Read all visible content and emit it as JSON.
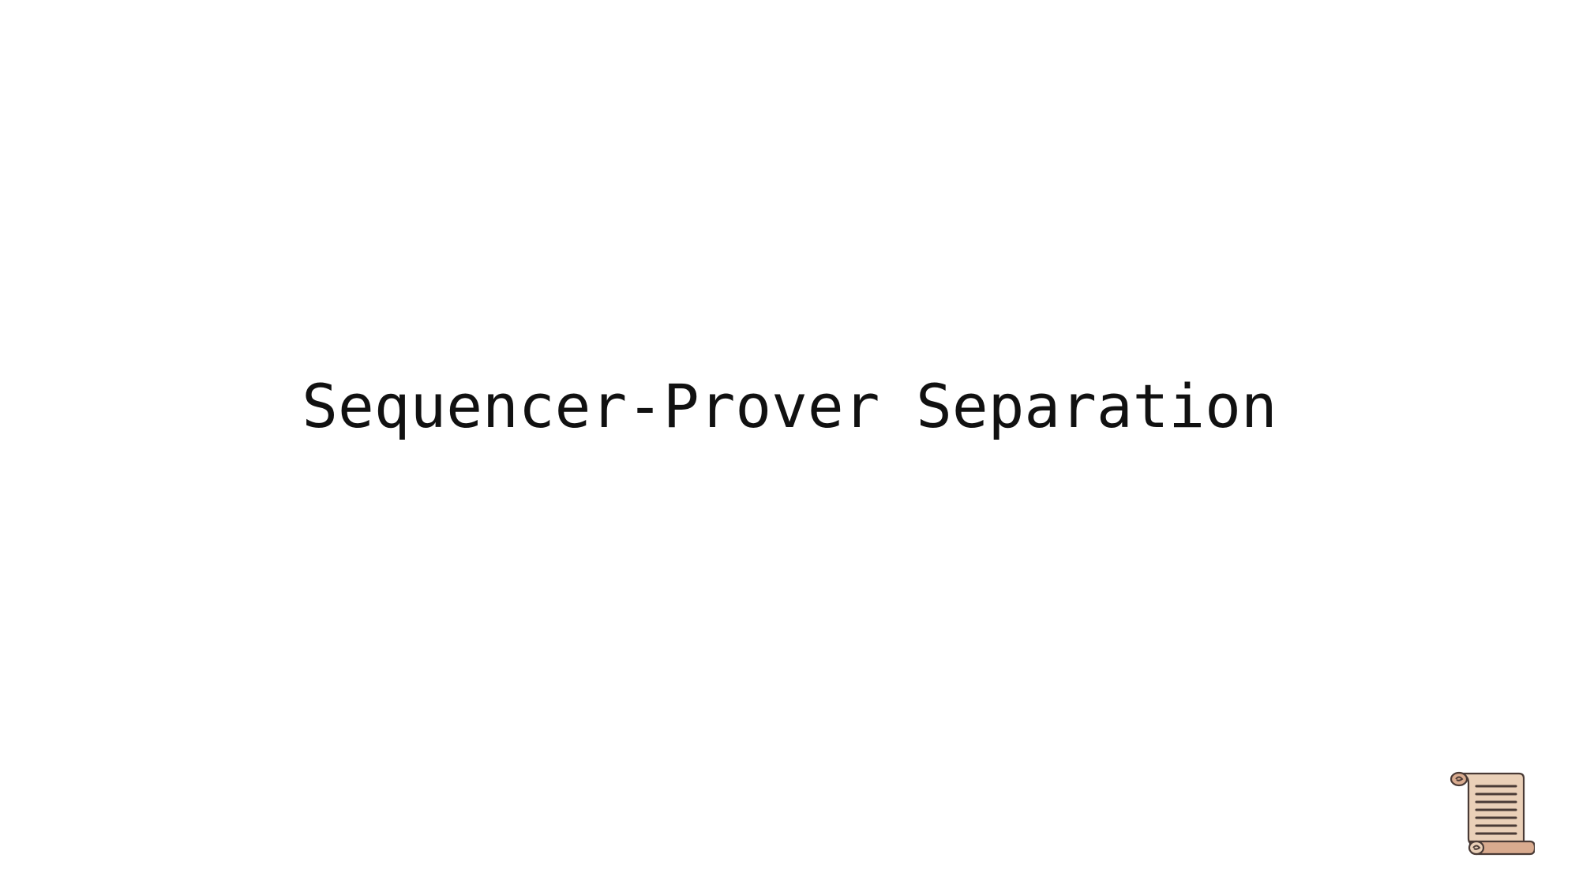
{
  "slide": {
    "title": "Sequencer-Prover Separation",
    "corner_icon": "scroll-icon",
    "colors": {
      "background": "#ffffff",
      "text": "#111111",
      "scroll_paper": "#ead0b8",
      "scroll_shadow": "#d9ab8f",
      "scroll_outline": "#4a3b36"
    }
  }
}
